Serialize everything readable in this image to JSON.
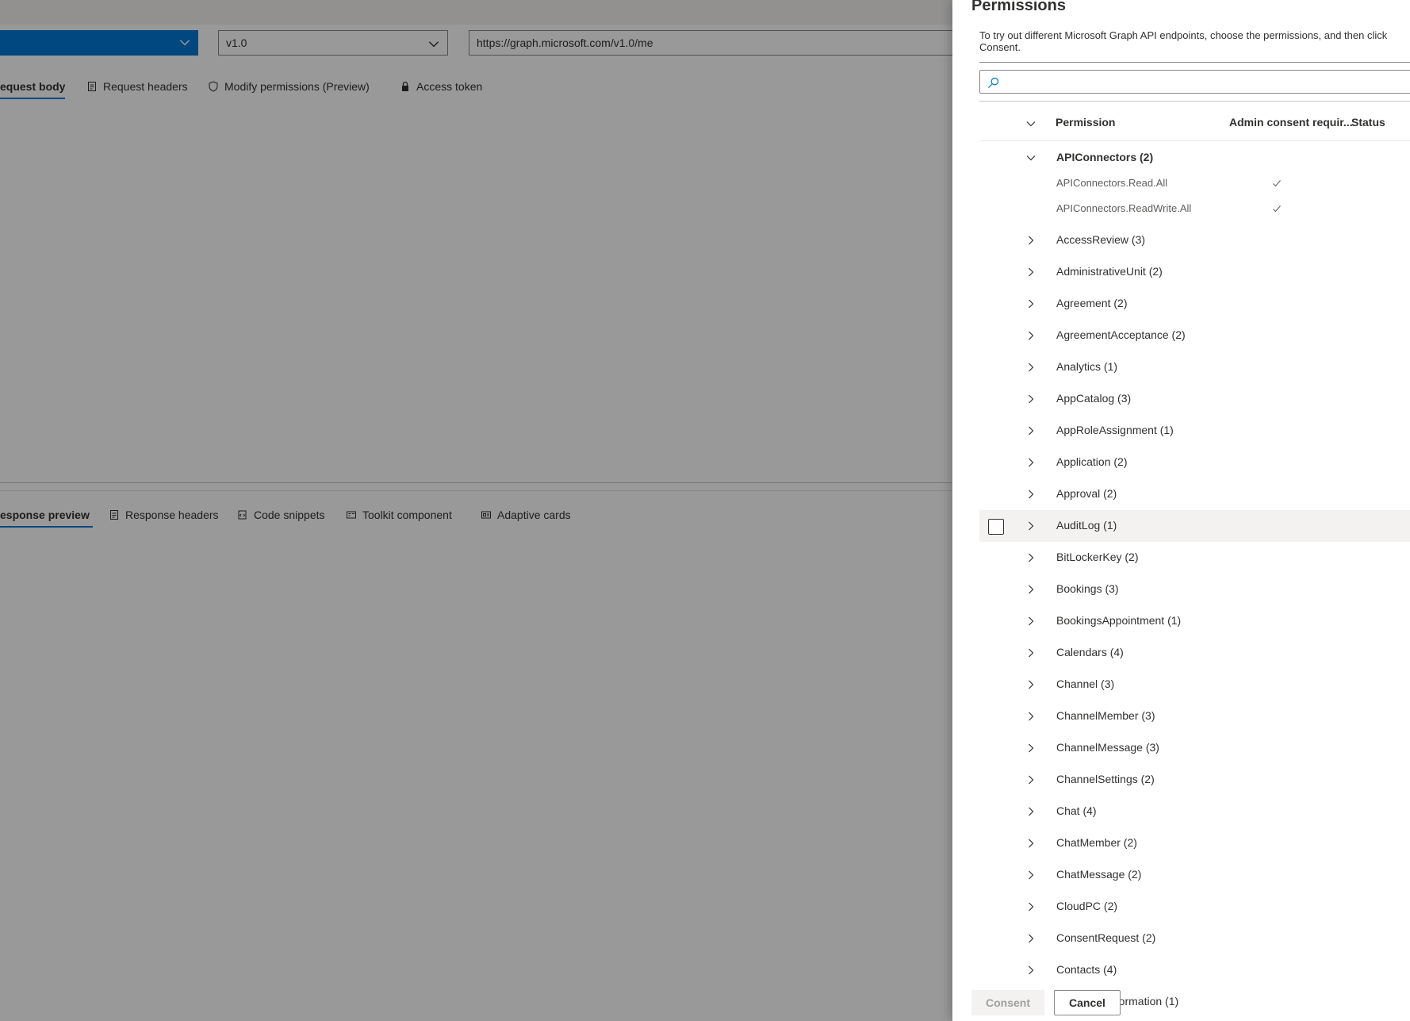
{
  "request": {
    "version": "v1.0",
    "url": "https://graph.microsoft.com/v1.0/me"
  },
  "request_tabs": [
    {
      "label": "equest body"
    },
    {
      "label": "Request headers"
    },
    {
      "label": "Modify permissions (Preview)"
    },
    {
      "label": "Access token"
    }
  ],
  "response_tabs": [
    {
      "label": "esponse preview"
    },
    {
      "label": "Response headers"
    },
    {
      "label": "Code snippets"
    },
    {
      "label": "Toolkit component"
    },
    {
      "label": "Adaptive cards"
    }
  ],
  "panel": {
    "title": "Permissions",
    "description": "To try out different Microsoft Graph API endpoints, choose the permissions, and then click Consent.",
    "search_placeholder": "",
    "columns": {
      "permission": "Permission",
      "admin_consent": "Admin consent requir...",
      "status": "Status"
    },
    "expanded_group": {
      "label": "APIConnectors (2)",
      "items": [
        {
          "label": "APIConnectors.Read.All",
          "admin_consent": true
        },
        {
          "label": "APIConnectors.ReadWrite.All",
          "admin_consent": true
        }
      ]
    },
    "groups": [
      "AccessReview (3)",
      "AdministrativeUnit (2)",
      "Agreement (2)",
      "AgreementAcceptance (2)",
      "Analytics (1)",
      "AppCatalog (3)",
      "AppRoleAssignment (1)",
      "Application (2)",
      "Approval (2)",
      "AuditLog (1)",
      "BitLockerKey (2)",
      "Bookings (3)",
      "BookingsAppointment (1)",
      "Calendars (4)",
      "Channel (3)",
      "ChannelMember (3)",
      "ChannelMessage (3)",
      "ChannelSettings (2)",
      "Chat (4)",
      "ChatMember (2)",
      "ChatMessage (2)",
      "CloudPC (2)",
      "ConsentRequest (2)",
      "Contacts (4)"
    ],
    "hovered_group_index": 9,
    "partial_label": "nformation (1)",
    "consent_label": "Consent",
    "cancel_label": "Cancel"
  },
  "colors": {
    "accent": "#0078d4",
    "overlay": "rgba(0,0,0,0.4)"
  }
}
